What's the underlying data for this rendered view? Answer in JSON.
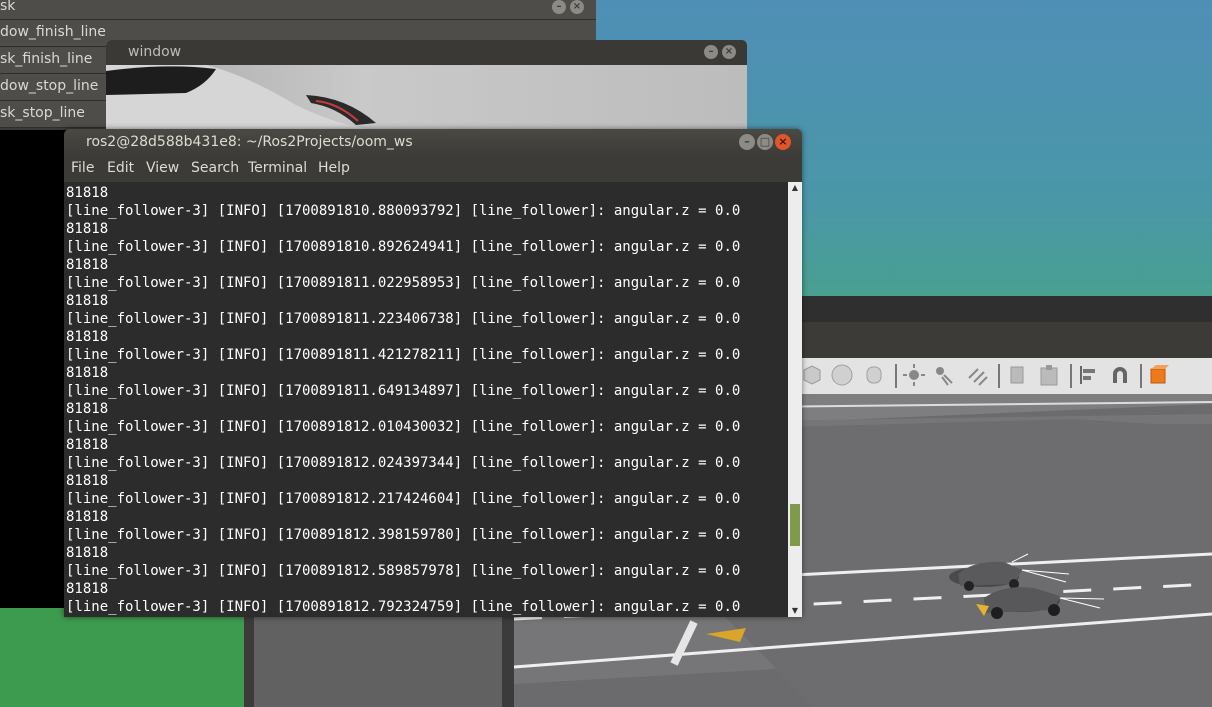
{
  "task_window": {
    "title_fragment": "sk",
    "items": [
      "dow_finish_line",
      "sk_finish_line",
      "dow_stop_line",
      "sk_stop_line"
    ]
  },
  "image_window": {
    "title": "window"
  },
  "terminal": {
    "title": "ros2@28d588b431e8: ~/Ros2Projects/oom_ws",
    "menu": [
      "File",
      "Edit",
      "View",
      "Search",
      "Terminal",
      "Help"
    ],
    "lines": [
      "81818",
      "[line_follower-3] [INFO] [1700891810.880093792] [line_follower]: angular.z = 0.0",
      "81818",
      "[line_follower-3] [INFO] [1700891810.892624941] [line_follower]: angular.z = 0.0",
      "81818",
      "[line_follower-3] [INFO] [1700891811.022958953] [line_follower]: angular.z = 0.0",
      "81818",
      "[line_follower-3] [INFO] [1700891811.223406738] [line_follower]: angular.z = 0.0",
      "81818",
      "[line_follower-3] [INFO] [1700891811.421278211] [line_follower]: angular.z = 0.0",
      "81818",
      "[line_follower-3] [INFO] [1700891811.649134897] [line_follower]: angular.z = 0.0",
      "81818",
      "[line_follower-3] [INFO] [1700891812.010430032] [line_follower]: angular.z = 0.0",
      "81818",
      "[line_follower-3] [INFO] [1700891812.024397344] [line_follower]: angular.z = 0.0",
      "81818",
      "[line_follower-3] [INFO] [1700891812.217424604] [line_follower]: angular.z = 0.0",
      "81818",
      "[line_follower-3] [INFO] [1700891812.398159780] [line_follower]: angular.z = 0.0",
      "81818",
      "[line_follower-3] [INFO] [1700891812.589857978] [line_follower]: angular.z = 0.0",
      "81818",
      "[line_follower-3] [INFO] [1700891812.792324759] [line_follower]: angular.z = 0.0"
    ]
  },
  "simulator": {
    "toolbar_icons": [
      "box-shape-icon",
      "sphere-shape-icon",
      "cylinder-shape-icon",
      "point-light-icon",
      "spot-light-icon",
      "directional-light-icon",
      "copy-icon",
      "paste-icon",
      "align-icon",
      "snap-icon",
      "view-angle-icon"
    ]
  },
  "colors": {
    "terminal_bg": "#2c2c2c",
    "terminal_text": "#ffffff",
    "close_button": "#e0552a",
    "scroll_thumb": "#7e9a4a",
    "desktop_green": "#3c9b4f"
  }
}
